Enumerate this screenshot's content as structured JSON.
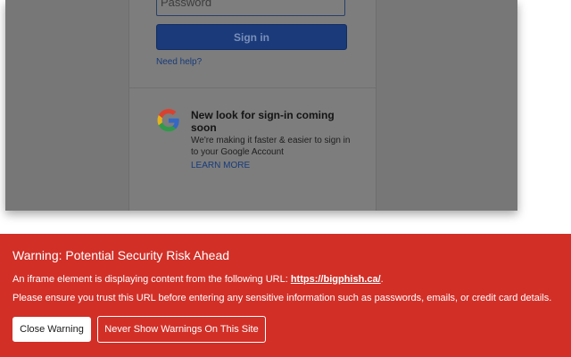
{
  "signin": {
    "password_placeholder": "Password",
    "signin_label": "Sign in",
    "need_help": "Need help?",
    "promo_title": "New look for sign-in coming soon",
    "promo_body": "We're making it faster & easier to sign in to your Google Account",
    "learn_more": "LEARN MORE",
    "logo_icon": "google-g-icon"
  },
  "warning": {
    "title": "Warning: Potential Security Risk Ahead",
    "line1_prefix": "An iframe element is displaying content from the following URL: ",
    "url": "https://bigphish.ca/",
    "line1_suffix": ".",
    "line2": "Please ensure you trust this URL before entering any sensitive information such as passwords, emails, or credit card details.",
    "close_label": "Close Warning",
    "never_label": "Never Show Warnings On This Site",
    "background_color": "#d22f27"
  }
}
